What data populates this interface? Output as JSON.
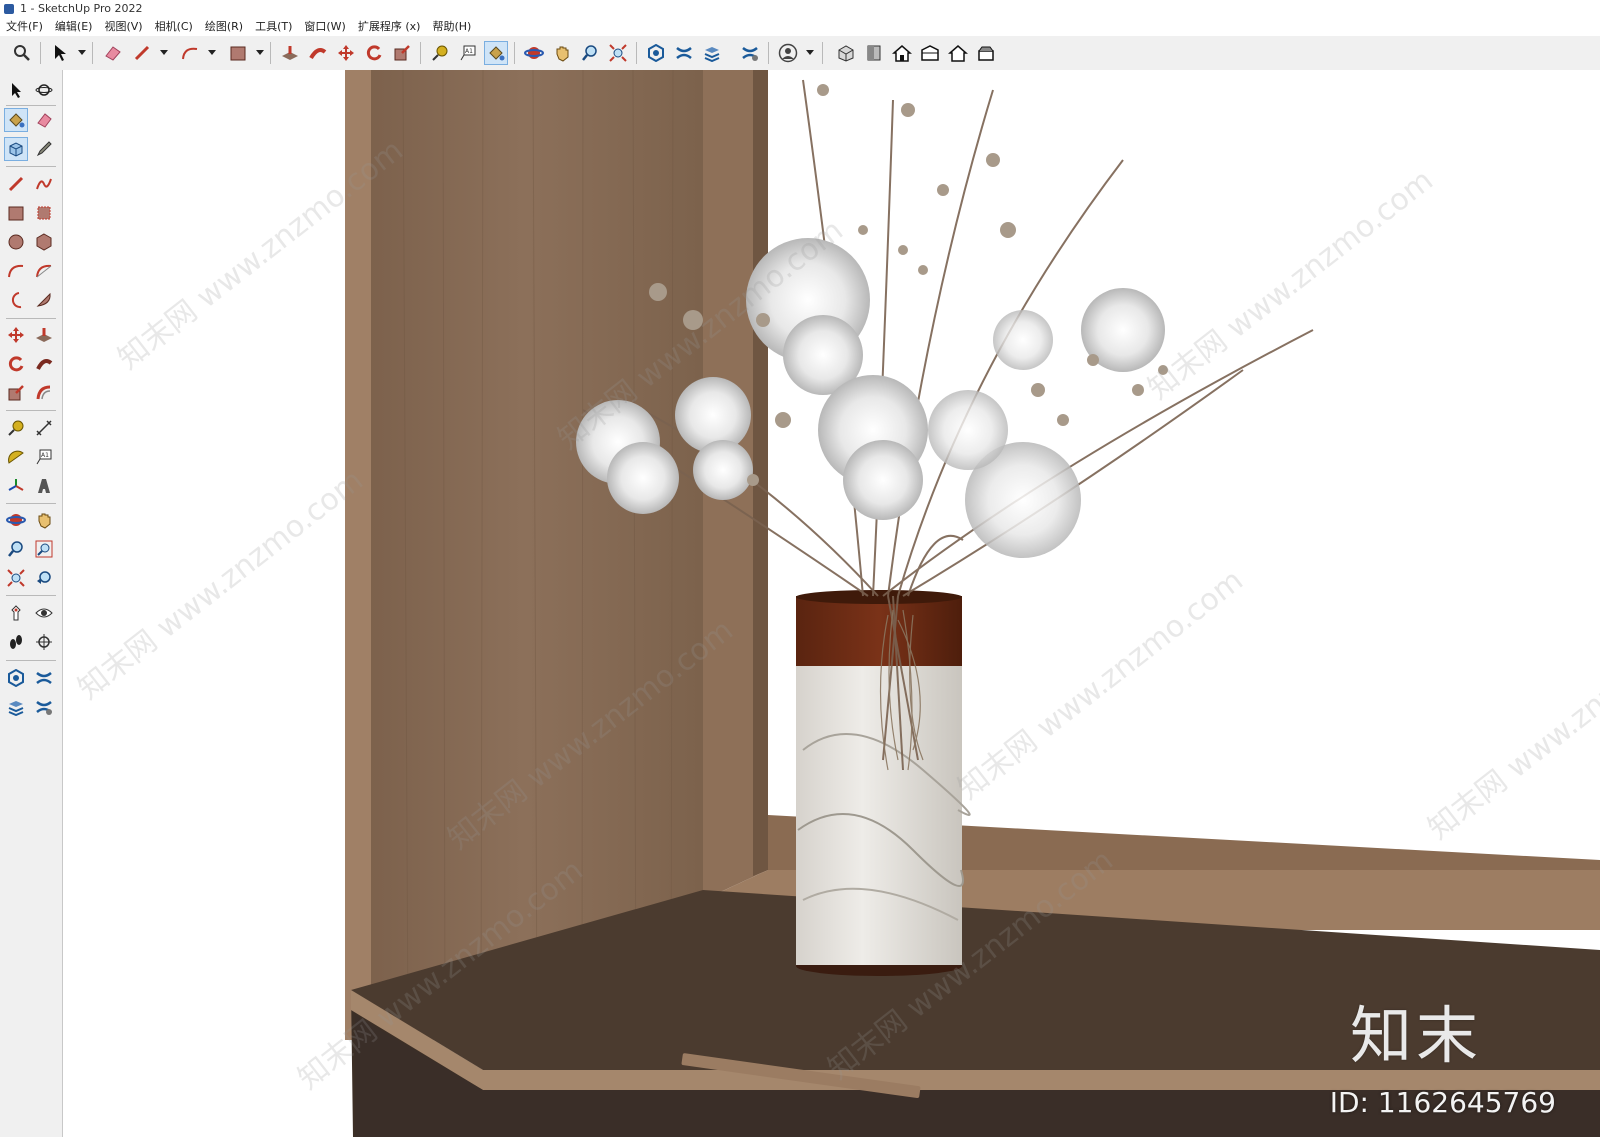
{
  "window": {
    "title": "1 - SketchUp Pro 2022"
  },
  "menu": [
    "文件(F)",
    "编辑(E)",
    "视图(V)",
    "相机(C)",
    "绘图(R)",
    "工具(T)",
    "窗口(W)",
    "扩展程序 (x)",
    "帮助(H)"
  ],
  "toolbar_icons": [
    "zoom-icon",
    "select-icon",
    "eraser-icon",
    "pencil-icon",
    "arc-icon",
    "rectangle-icon",
    "push-pull-icon",
    "follow-me-icon",
    "move-icon",
    "rotate-icon",
    "scale-icon",
    "tape-measure-icon",
    "text-icon",
    "paint-bucket-icon",
    "orbit-icon",
    "pan-icon",
    "zoom-tool-icon",
    "zoom-extents-icon",
    "warehouse-icon",
    "extension-warehouse-icon",
    "layout-icon",
    "extension-manager-icon",
    "account-icon",
    "iso-view-icon",
    "top-view-icon",
    "front-view-icon",
    "right-view-icon",
    "back-view-icon",
    "left-view-icon"
  ],
  "left_toolbar_icons": [
    "select-icon",
    "orbit-icon",
    "paint-bucket-icon",
    "eraser-icon",
    "component-icon",
    "tag-icon",
    "line-icon",
    "freehand-icon",
    "rectangle-icon",
    "rotated-rectangle-icon",
    "circle-icon",
    "polygon-icon",
    "arc-icon",
    "two-point-arc-icon",
    "three-point-arc-icon",
    "pie-icon",
    "move-icon",
    "push-pull-icon",
    "rotate-icon",
    "follow-me-icon",
    "scale-icon",
    "offset-icon",
    "tape-measure-icon",
    "dimension-icon",
    "protractor-icon",
    "text-icon",
    "axes-icon",
    "3d-text-icon",
    "orbit-icon",
    "pan-icon",
    "zoom-icon",
    "zoom-window-icon",
    "zoom-extents-icon",
    "previous-view-icon",
    "position-camera-icon",
    "look-around-icon",
    "walk-icon",
    "section-plane-icon",
    "warehouse-icon",
    "extension-warehouse-icon",
    "layout-icon",
    "extension-manager-icon"
  ],
  "colors": {
    "chrome": "#f0f0f0",
    "wood_light": "#8b6f55",
    "wood_dark": "#4a3a2e",
    "vase_band": "#6b2a14",
    "marble": "#e4e2de"
  },
  "watermark": {
    "text": "知末网 www.znzmo.com"
  },
  "brand": {
    "mark": "知末",
    "id": "ID: 1162645769"
  }
}
